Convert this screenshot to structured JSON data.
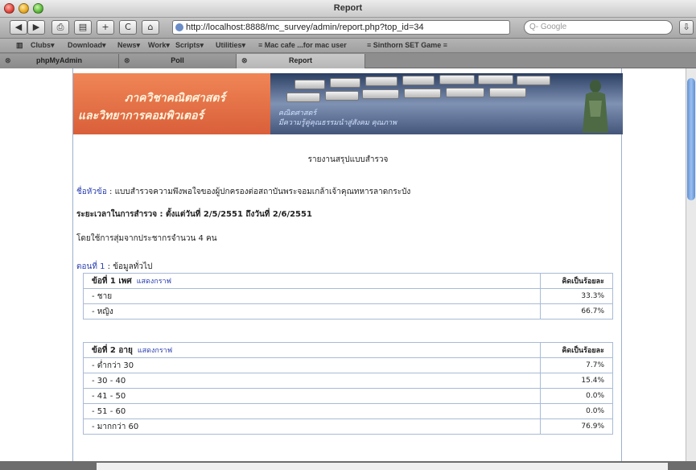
{
  "window": {
    "title": "Report"
  },
  "toolbar": {
    "back_icon": "back-arrow-icon",
    "forward_icon": "forward-arrow-icon",
    "url": "http://localhost:8888/mc_survey/admin/report.php?top_id=34",
    "search_placeholder": "Q- Google"
  },
  "bookmarks": [
    "Clubs▾",
    "Download▾",
    "News▾",
    "Work▾",
    "Scripts▾",
    "Utilities▾",
    "≡ Mac cafe ...for mac user",
    "≡ Sinthorn SET Game ≡"
  ],
  "tabs": [
    {
      "label": "phpMyAdmin"
    },
    {
      "label": "Poll"
    },
    {
      "label": "Report",
      "active": true
    }
  ],
  "banner": {
    "line1": "ภาควิชาคณิตศาสตร์",
    "line2": "และวิทยาการคอมพิวเตอร์",
    "sub1": "คณิตศาสตร์",
    "sub2": "มีความรู้คู่คุณธรรมนำสู่สังคม คุณภาพ"
  },
  "report": {
    "title": "รายงานสรุปแบบสำรวจ",
    "topic_label": "ชื่อหัวข้อ",
    "topic_value": " : แบบสำรวจความพึงพอใจของผู้ปกครองต่อสถาบันพระจอมเกล้าเจ้าคุณทหารลาดกระบัง",
    "period": "ระยะเวลาในการสำรวจ : ตั้งแต่วันที่ 2/5/2551 ถึงวันที่ 2/6/2551",
    "sample": "โดยใช้การสุ่มจากประชากรจำนวน 4 คน",
    "part_label": "ตอนที่ 1",
    "part_value": " : ข้อมูลทั่วไป"
  },
  "questions": [
    {
      "title": "ข้อที่ 1 เพศ",
      "graph_link": "แสดงกราฟ",
      "pct_header": "คิดเป็นร้อยละ",
      "rows": [
        {
          "label": "- ชาย",
          "value": "33.3%"
        },
        {
          "label": "- หญิง",
          "value": "66.7%"
        }
      ]
    },
    {
      "title": "ข้อที่ 2 อายุ",
      "graph_link": "แสดงกราฟ",
      "pct_header": "คิดเป็นร้อยละ",
      "rows": [
        {
          "label": "- ต่ำกว่า 30",
          "value": "7.7%"
        },
        {
          "label": "- 30 - 40",
          "value": "15.4%"
        },
        {
          "label": "- 41 - 50",
          "value": "0.0%"
        },
        {
          "label": "- 51 - 60",
          "value": "0.0%"
        },
        {
          "label": "- มากกว่า 60",
          "value": "76.9%"
        }
      ]
    }
  ]
}
